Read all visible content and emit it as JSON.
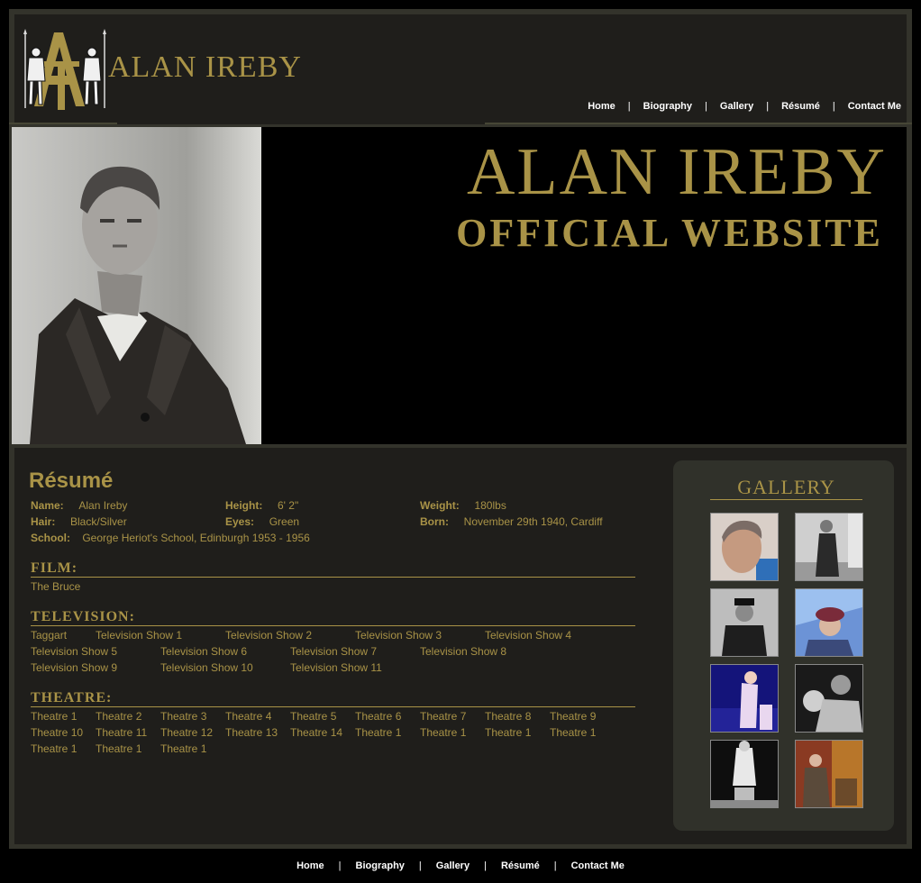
{
  "site": {
    "logo_text": "ALAN IREBY",
    "banner_title": "ALAN IREBY",
    "banner_subtitle": "OFFICIAL WEBSITE"
  },
  "nav": {
    "home": "Home",
    "biography": "Biography",
    "gallery": "Gallery",
    "resume": "Résumé",
    "contact": "Contact Me",
    "separator": "|"
  },
  "resume": {
    "title": "Résumé",
    "name_label": "Name:",
    "name_value": "Alan Ireby",
    "height_label": "Height:",
    "height_value": "6' 2\"",
    "weight_label": "Weight:",
    "weight_value": "180lbs",
    "hair_label": "Hair:",
    "hair_value": "Black/Silver",
    "eyes_label": "Eyes:",
    "eyes_value": "Green",
    "born_label": "Born:",
    "born_value": "November 29th 1940, Cardiff",
    "school_label": "School:",
    "school_value": "George Heriot's School, Edinburgh 1953 - 1956"
  },
  "film": {
    "heading": "FILM:",
    "items": [
      "The Bruce"
    ]
  },
  "television": {
    "heading": "TELEVISION:",
    "items": [
      "Taggart",
      "Television Show 1",
      "Television Show 2",
      "Television Show 3",
      "Television Show 4",
      "Television Show 5",
      "Television Show 6",
      "Television Show 7",
      "Television Show 8",
      "Television Show 9",
      "Television Show 10",
      "Television Show 11"
    ]
  },
  "theatre": {
    "heading": "THEATRE:",
    "items": [
      "Theatre 1",
      "Theatre 2",
      "Theatre 3",
      "Theatre 4",
      "Theatre 5",
      "Theatre 6",
      "Theatre 7",
      "Theatre 8",
      "Theatre 9",
      "Theatre 10",
      "Theatre 11",
      "Theatre 12",
      "Theatre 13",
      "Theatre 14",
      "Theatre 1",
      "Theatre 1",
      "Theatre 1",
      "Theatre 1",
      "Theatre 1",
      "Theatre 1",
      "Theatre 1"
    ]
  },
  "gallery": {
    "title": "GALLERY"
  },
  "colors": {
    "gold": "#a99347",
    "panel": "#1f1e1b",
    "gallery_panel": "#30312a"
  }
}
